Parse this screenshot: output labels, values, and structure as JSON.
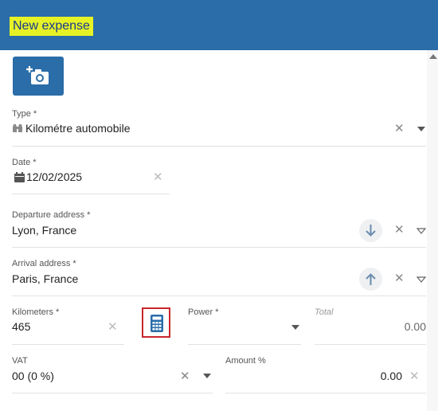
{
  "header": {
    "title": "New expense"
  },
  "type_field": {
    "label": "Type *",
    "value": "Kilométre automobile",
    "clear": "✕"
  },
  "date_field": {
    "label": "Date *",
    "value": "12/02/2025",
    "clear": "✕"
  },
  "departure_field": {
    "label": "Departure address *",
    "value": "Lyon, France",
    "clear": "✕"
  },
  "arrival_field": {
    "label": "Arrival address *",
    "value": "Paris, France",
    "clear": "✕"
  },
  "kilometers_field": {
    "label": "Kilometers *",
    "value": "465",
    "clear": "✕"
  },
  "power_field": {
    "label": "Power *",
    "value": ""
  },
  "total_field": {
    "label": "Total",
    "value": "0.00"
  },
  "vat_field": {
    "label": "VAT",
    "value": "00 (0 %)",
    "clear": "✕"
  },
  "amount_field": {
    "label": "Amount %",
    "value": "0.00",
    "clear": "✕"
  },
  "colors": {
    "header": "#2a6da8",
    "title_highlight": "#e6f226",
    "calc_border": "#c9262c"
  }
}
